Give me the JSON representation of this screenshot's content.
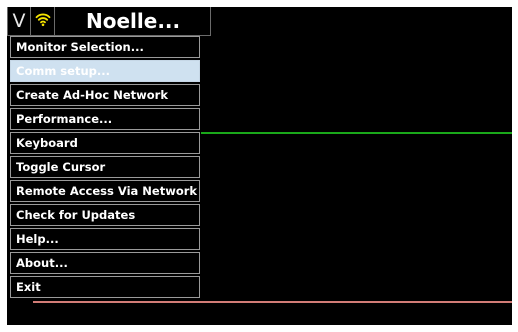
{
  "topbar": {
    "v_label": "V",
    "wifi_icon": "wifi-icon",
    "wifi_color": "#f5e400",
    "title": "Noelle..."
  },
  "menu": {
    "items": [
      {
        "label": "Monitor Selection...",
        "enabled": true
      },
      {
        "label": "Comm setup...",
        "enabled": false
      },
      {
        "label": "Create Ad-Hoc Network",
        "enabled": true
      },
      {
        "label": "Performance...",
        "enabled": true
      },
      {
        "label": "Keyboard",
        "enabled": true
      },
      {
        "label": "Toggle Cursor",
        "enabled": true
      },
      {
        "label": "Remote Access Via Network",
        "enabled": true
      },
      {
        "label": "Check for Updates",
        "enabled": true
      },
      {
        "label": "Help...",
        "enabled": true
      },
      {
        "label": "About...",
        "enabled": true
      },
      {
        "label": "Exit",
        "enabled": true
      }
    ]
  },
  "colors": {
    "background": "#000000",
    "trace_green": "#1aa81a",
    "trace_red": "#d27c76",
    "disabled_item_bg": "#cfe1f0"
  }
}
